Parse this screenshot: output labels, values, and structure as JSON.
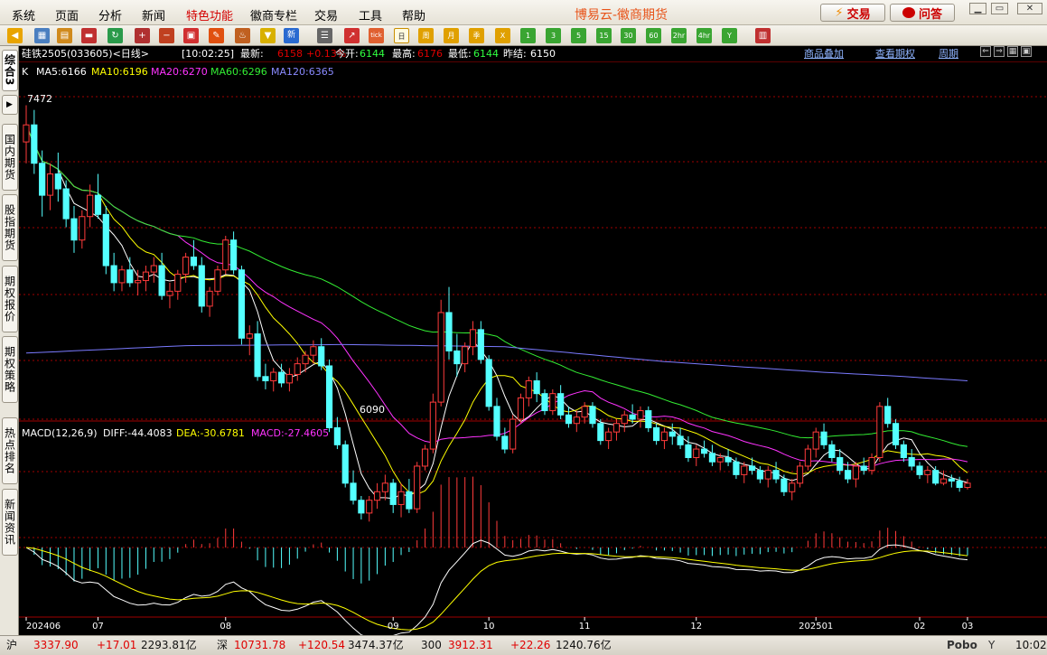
{
  "menu": {
    "items": [
      "系统",
      "页面",
      "分析",
      "新闻",
      "特色功能",
      "徽商专栏",
      "交易",
      "工具",
      "帮助"
    ],
    "app_title": "博易云-徽商期货",
    "trade_label": "交易",
    "ask_label": "问答"
  },
  "sidebar": {
    "tabs": [
      "综合3",
      "国内期货",
      "股指期货",
      "期权报价",
      "期权策略",
      "热点排名",
      "新闻资讯"
    ]
  },
  "quote": {
    "symbol": "硅铁2505(033605)<日线>",
    "time": "[10:02:25]",
    "last_label": "最新:",
    "last": "6158",
    "change": "+0.13%",
    "open_label": "今开:",
    "open": "6144",
    "high_label": "最高:",
    "high": "6176",
    "low_label": "最低:",
    "low": "6144",
    "prev_label": "昨结:",
    "prev": "6150",
    "links": [
      "商品叠加",
      "查看期权",
      "周期"
    ]
  },
  "ma": {
    "k_label": "K",
    "ma5": "MA5:6166",
    "ma10": "MA10:6196",
    "ma20": "MA20:6270",
    "ma60": "MA60:6296",
    "ma120": "MA120:6365"
  },
  "macd": {
    "label": "MACD(12,26,9)",
    "diff": "DIFF:-44.4083",
    "dea": "DEA:-30.6781",
    "macd": "MACD:-27.4605"
  },
  "annotations": {
    "high": "7472",
    "low": "6090"
  },
  "xaxis": [
    "202406",
    "07",
    "08",
    "09",
    "10",
    "11",
    "12",
    "202501",
    "02",
    "03"
  ],
  "colors": {
    "up": "#ff3b3b",
    "down": "#54ffff",
    "ma5": "#ffffff",
    "ma10": "#ffff00",
    "ma20": "#ff33ff",
    "ma60": "#33ee33",
    "ma120": "#7a7aff",
    "grid": "#a00000"
  },
  "status": {
    "sh_label": "沪",
    "sh_index": "3337.90",
    "sh_change": "+17.01",
    "sh_amount": "2293.81亿",
    "sz_label": "深",
    "sz_index": "10731.78",
    "sz_change": "+120.54",
    "sz_amount": "3474.37亿",
    "c300_label": "300",
    "c300_index": "3912.31",
    "c300_change": "+22.26",
    "c300_amount": "1240.76亿",
    "brand": "Pobo",
    "clock": "10:02"
  },
  "chart_data": {
    "type": "candlestick",
    "title": "硅铁2505(033605)<日线>",
    "price_ylim": [
      6000,
      7580
    ],
    "candles": [
      [
        7300,
        7472,
        7200,
        7380
      ],
      [
        7380,
        7450,
        7150,
        7200
      ],
      [
        7200,
        7260,
        6950,
        7050
      ],
      [
        7050,
        7200,
        6980,
        7150
      ],
      [
        7150,
        7250,
        7020,
        7080
      ],
      [
        7080,
        7120,
        6900,
        6940
      ],
      [
        6940,
        7000,
        6780,
        6840
      ],
      [
        6840,
        6980,
        6800,
        6950
      ],
      [
        6950,
        7100,
        6900,
        7050
      ],
      [
        7050,
        7150,
        6940,
        6960
      ],
      [
        6960,
        7000,
        6680,
        6720
      ],
      [
        6720,
        6780,
        6600,
        6640
      ],
      [
        6640,
        6720,
        6600,
        6700
      ],
      [
        6700,
        6760,
        6620,
        6640
      ],
      [
        6640,
        6700,
        6580,
        6650
      ],
      [
        6650,
        6720,
        6600,
        6690
      ],
      [
        6690,
        6760,
        6640,
        6720
      ],
      [
        6720,
        6780,
        6560,
        6580
      ],
      [
        6580,
        6640,
        6520,
        6600
      ],
      [
        6600,
        6700,
        6560,
        6680
      ],
      [
        6680,
        6780,
        6640,
        6760
      ],
      [
        6760,
        6840,
        6700,
        6720
      ],
      [
        6720,
        6760,
        6500,
        6530
      ],
      [
        6530,
        6620,
        6480,
        6600
      ],
      [
        6600,
        6720,
        6580,
        6700
      ],
      [
        6700,
        6860,
        6680,
        6840
      ],
      [
        6840,
        6880,
        6680,
        6700
      ],
      [
        6700,
        6720,
        6350,
        6380
      ],
      [
        6380,
        6440,
        6300,
        6400
      ],
      [
        6400,
        6460,
        6180,
        6200
      ],
      [
        6200,
        6260,
        6140,
        6180
      ],
      [
        6180,
        6240,
        6130,
        6220
      ],
      [
        6220,
        6260,
        6150,
        6170
      ],
      [
        6170,
        6240,
        6130,
        6210
      ],
      [
        6210,
        6290,
        6180,
        6260
      ],
      [
        6260,
        6320,
        6220,
        6300
      ],
      [
        6300,
        6370,
        6260,
        6340
      ],
      [
        6340,
        6380,
        6230,
        6250
      ],
      [
        6250,
        6280,
        5940,
        5960
      ],
      [
        5960,
        6010,
        5860,
        5880
      ],
      [
        5880,
        5900,
        5680,
        5700
      ],
      [
        5700,
        5760,
        5600,
        5620
      ],
      [
        5620,
        5640,
        5530,
        5560
      ],
      [
        5560,
        5640,
        5520,
        5620
      ],
      [
        5620,
        5700,
        5580,
        5660
      ],
      [
        5660,
        5740,
        5620,
        5700
      ],
      [
        5700,
        5720,
        5560,
        5600
      ],
      [
        5600,
        5700,
        5540,
        5660
      ],
      [
        5660,
        5720,
        5560,
        5580
      ],
      [
        5580,
        5800,
        5560,
        5780
      ],
      [
        5780,
        5880,
        5760,
        5860
      ],
      [
        5860,
        6120,
        5840,
        6080
      ],
      [
        6080,
        6560,
        6060,
        6500
      ],
      [
        6500,
        6620,
        6280,
        6320
      ],
      [
        6320,
        6400,
        6200,
        6260
      ],
      [
        6260,
        6360,
        6220,
        6340
      ],
      [
        6340,
        6460,
        6300,
        6420
      ],
      [
        6420,
        6460,
        6260,
        6280
      ],
      [
        6280,
        6300,
        6040,
        6060
      ],
      [
        6060,
        6100,
        5900,
        5920
      ],
      [
        5920,
        5960,
        5840,
        5860
      ],
      [
        5860,
        6020,
        5840,
        6000
      ],
      [
        6000,
        6120,
        5980,
        6100
      ],
      [
        6100,
        6200,
        6060,
        6180
      ],
      [
        6180,
        6220,
        6080,
        6120
      ],
      [
        6120,
        6140,
        6020,
        6040
      ],
      [
        6040,
        6140,
        6020,
        6120
      ],
      [
        6120,
        6160,
        6000,
        6020
      ],
      [
        6020,
        6060,
        5960,
        5980
      ],
      [
        5980,
        6040,
        5940,
        6010
      ],
      [
        6010,
        6080,
        5980,
        6060
      ],
      [
        6060,
        6080,
        5960,
        5980
      ],
      [
        5980,
        6000,
        5880,
        5900
      ],
      [
        5900,
        5960,
        5860,
        5940
      ],
      [
        5940,
        6000,
        5900,
        5980
      ],
      [
        5980,
        6040,
        5940,
        6020
      ],
      [
        6020,
        6070,
        5980,
        6000
      ],
      [
        6000,
        6060,
        5960,
        6040
      ],
      [
        6040,
        6060,
        5940,
        5960
      ],
      [
        5960,
        5980,
        5880,
        5900
      ],
      [
        5900,
        5960,
        5860,
        5940
      ],
      [
        5940,
        5980,
        5880,
        5920
      ],
      [
        5920,
        5960,
        5860,
        5880
      ],
      [
        5880,
        5920,
        5800,
        5820
      ],
      [
        5820,
        5880,
        5780,
        5860
      ],
      [
        5860,
        5900,
        5820,
        5840
      ],
      [
        5840,
        5880,
        5780,
        5800
      ],
      [
        5800,
        5840,
        5760,
        5820
      ],
      [
        5820,
        5860,
        5780,
        5800
      ],
      [
        5800,
        5820,
        5720,
        5740
      ],
      [
        5740,
        5800,
        5700,
        5780
      ],
      [
        5780,
        5820,
        5740,
        5760
      ],
      [
        5760,
        5780,
        5700,
        5720
      ],
      [
        5720,
        5780,
        5680,
        5760
      ],
      [
        5760,
        5800,
        5700,
        5720
      ],
      [
        5720,
        5740,
        5640,
        5660
      ],
      [
        5660,
        5720,
        5620,
        5700
      ],
      [
        5700,
        5800,
        5680,
        5780
      ],
      [
        5780,
        5880,
        5760,
        5860
      ],
      [
        5860,
        5960,
        5820,
        5940
      ],
      [
        5940,
        5980,
        5860,
        5880
      ],
      [
        5880,
        5900,
        5800,
        5820
      ],
      [
        5820,
        5860,
        5740,
        5760
      ],
      [
        5760,
        5800,
        5700,
        5720
      ],
      [
        5720,
        5800,
        5680,
        5780
      ],
      [
        5780,
        5820,
        5740,
        5760
      ],
      [
        5760,
        5840,
        5740,
        5820
      ],
      [
        5820,
        6080,
        5800,
        6060
      ],
      [
        6060,
        6100,
        5960,
        5980
      ],
      [
        5980,
        6000,
        5860,
        5880
      ],
      [
        5880,
        5900,
        5800,
        5820
      ],
      [
        5820,
        5860,
        5760,
        5780
      ],
      [
        5780,
        5800,
        5720,
        5740
      ],
      [
        5740,
        5780,
        5700,
        5760
      ],
      [
        5760,
        5780,
        5690,
        5700
      ],
      [
        5700,
        5760,
        5690,
        5720
      ],
      [
        5720,
        5740,
        5680,
        5710
      ],
      [
        5710,
        5730,
        5660,
        5680
      ],
      [
        5680,
        5720,
        5670,
        5700
      ]
    ],
    "ma120": [
      [
        0,
        6310
      ],
      [
        20,
        6345
      ],
      [
        40,
        6350
      ],
      [
        60,
        6340
      ],
      [
        80,
        6270
      ],
      [
        100,
        6220
      ],
      [
        110,
        6200
      ],
      [
        118,
        6180
      ]
    ],
    "macd_panel": {
      "diff": -44.4083,
      "dea": -30.6781,
      "macd": -27.4605
    }
  }
}
